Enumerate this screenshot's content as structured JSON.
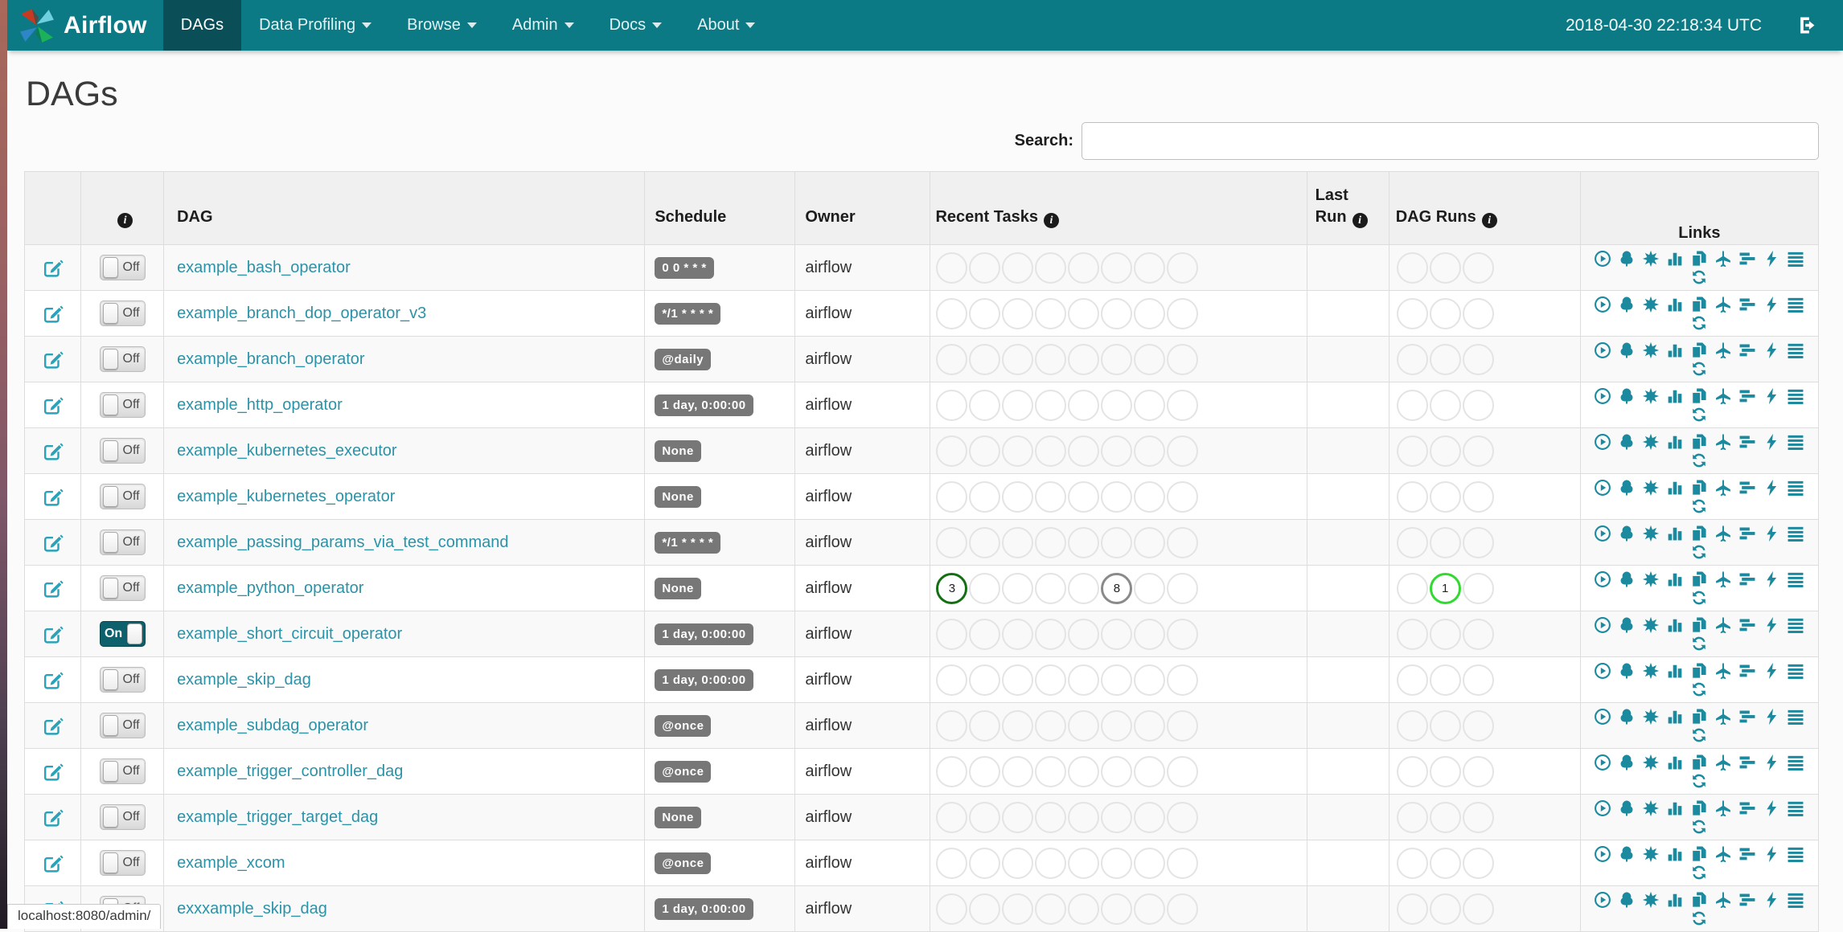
{
  "navbar": {
    "brand": "Airflow",
    "items": [
      {
        "label": "DAGs",
        "active": true,
        "caret": false
      },
      {
        "label": "Data Profiling",
        "active": false,
        "caret": true
      },
      {
        "label": "Browse",
        "active": false,
        "caret": true
      },
      {
        "label": "Admin",
        "active": false,
        "caret": true
      },
      {
        "label": "Docs",
        "active": false,
        "caret": true
      },
      {
        "label": "About",
        "active": false,
        "caret": true
      }
    ],
    "clock": "2018-04-30 22:18:34 UTC"
  },
  "page": {
    "title": "DAGs"
  },
  "search": {
    "label": "Search:",
    "value": "",
    "placeholder": ""
  },
  "icons": {
    "info_glyph": "i"
  },
  "table": {
    "headers": {
      "edit": "",
      "info": "",
      "dag": "DAG",
      "schedule": "Schedule",
      "owner": "Owner",
      "recent_tasks": "Recent Tasks",
      "last_run": "Last Run",
      "dag_runs": "DAG Runs",
      "links": "Links"
    },
    "recent_task_slots": 8,
    "dag_run_slots": 3,
    "rows": [
      {
        "dag": "example_bash_operator",
        "toggle": "Off",
        "schedule": "0 0 * * *",
        "owner": "airflow",
        "last_run": "",
        "recent_tasks": {},
        "dag_runs": {}
      },
      {
        "dag": "example_branch_dop_operator_v3",
        "toggle": "Off",
        "schedule": "*/1 * * * *",
        "owner": "airflow",
        "last_run": "",
        "recent_tasks": {},
        "dag_runs": {}
      },
      {
        "dag": "example_branch_operator",
        "toggle": "Off",
        "schedule": "@daily",
        "owner": "airflow",
        "last_run": "",
        "recent_tasks": {},
        "dag_runs": {}
      },
      {
        "dag": "example_http_operator",
        "toggle": "Off",
        "schedule": "1 day, 0:00:00",
        "owner": "airflow",
        "last_run": "",
        "recent_tasks": {},
        "dag_runs": {}
      },
      {
        "dag": "example_kubernetes_executor",
        "toggle": "Off",
        "schedule": "None",
        "owner": "airflow",
        "last_run": "",
        "recent_tasks": {},
        "dag_runs": {}
      },
      {
        "dag": "example_kubernetes_operator",
        "toggle": "Off",
        "schedule": "None",
        "owner": "airflow",
        "last_run": "",
        "recent_tasks": {},
        "dag_runs": {}
      },
      {
        "dag": "example_passing_params_via_test_command",
        "toggle": "Off",
        "schedule": "*/1 * * * *",
        "owner": "airflow",
        "last_run": "",
        "recent_tasks": {},
        "dag_runs": {}
      },
      {
        "dag": "example_python_operator",
        "toggle": "Off",
        "schedule": "None",
        "owner": "airflow",
        "last_run": "",
        "recent_tasks": {
          "1": {
            "count": "3",
            "state": "success"
          },
          "6": {
            "count": "8",
            "state": "none"
          }
        },
        "dag_runs": {
          "2": {
            "count": "1",
            "state": "running"
          }
        }
      },
      {
        "dag": "example_short_circuit_operator",
        "toggle": "On",
        "schedule": "1 day, 0:00:00",
        "owner": "airflow",
        "last_run": "",
        "recent_tasks": {},
        "dag_runs": {}
      },
      {
        "dag": "example_skip_dag",
        "toggle": "Off",
        "schedule": "1 day, 0:00:00",
        "owner": "airflow",
        "last_run": "",
        "recent_tasks": {},
        "dag_runs": {}
      },
      {
        "dag": "example_subdag_operator",
        "toggle": "Off",
        "schedule": "@once",
        "owner": "airflow",
        "last_run": "",
        "recent_tasks": {},
        "dag_runs": {}
      },
      {
        "dag": "example_trigger_controller_dag",
        "toggle": "Off",
        "schedule": "@once",
        "owner": "airflow",
        "last_run": "",
        "recent_tasks": {},
        "dag_runs": {}
      },
      {
        "dag": "example_trigger_target_dag",
        "toggle": "Off",
        "schedule": "None",
        "owner": "airflow",
        "last_run": "",
        "recent_tasks": {},
        "dag_runs": {}
      },
      {
        "dag": "example_xcom",
        "toggle": "Off",
        "schedule": "@once",
        "owner": "airflow",
        "last_run": "",
        "recent_tasks": {},
        "dag_runs": {}
      },
      {
        "dag": "exxxample_skip_dag",
        "toggle": "Off",
        "schedule": "1 day, 0:00:00",
        "owner": "airflow",
        "last_run": "",
        "recent_tasks": {},
        "dag_runs": {}
      }
    ]
  },
  "links": {
    "icons": [
      "play-circle",
      "tree",
      "sunburst",
      "bar-chart",
      "copy",
      "plane",
      "gantt",
      "bolt",
      "menu",
      "refresh"
    ]
  },
  "statusbar": {
    "url": "localhost:8080/admin/"
  },
  "colors": {
    "navbar": "#0c7a85",
    "navbar_active": "#0a4f58",
    "accent_teal": "#1b8a9f",
    "dag_link": "#2a93a8",
    "badge_bg": "#777777",
    "state_success": "#127012",
    "state_none": "#8a8a8a",
    "state_running": "#31d931"
  }
}
